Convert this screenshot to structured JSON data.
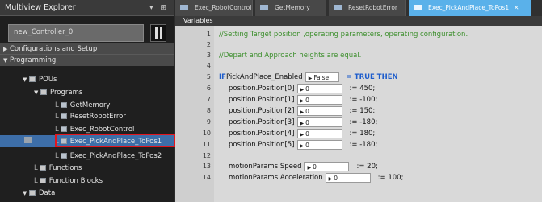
{
  "explorer": {
    "title": "Multiview Explorer",
    "controls": "▾ ⊞",
    "controller": "new_Controller_0",
    "tree": [
      {
        "label": "Configurations and Setup",
        "level": 0,
        "arrow": "▶"
      },
      {
        "label": "Programming",
        "level": 0,
        "arrow": "▼"
      },
      {
        "label": "POUs",
        "level": 1,
        "arrow": "▼"
      },
      {
        "label": "Programs",
        "level": 2,
        "arrow": "▼"
      },
      {
        "label": "GetMemory",
        "level": 3
      },
      {
        "label": "ResetRobotError",
        "level": 3
      },
      {
        "label": "Exec_RobotControl",
        "level": 3
      },
      {
        "label": "Exec_PickAndPlace_ToPos1",
        "level": 3,
        "selected": true
      },
      {
        "label": "Exec_PickAndPlace_ToPos2",
        "level": 3
      },
      {
        "label": "Functions",
        "level": 2
      },
      {
        "label": "Function Blocks",
        "level": 2
      },
      {
        "label": "Data",
        "level": 1,
        "arrow": "▼"
      }
    ]
  },
  "tabs": [
    {
      "label": "Exec_RobotControl"
    },
    {
      "label": "GetMemory"
    },
    {
      "label": "ResetRobotError"
    },
    {
      "label": "Exec_PickAndPlace_ToPos1",
      "active": true,
      "close": "✕"
    }
  ],
  "editor": {
    "variables_label": "Variables",
    "lines": [
      {
        "n": "1",
        "comment": "//Setting Target position ,operating parameters, operating configuration."
      },
      {
        "n": "2"
      },
      {
        "n": "3",
        "comment": "//Depart and Approach heights are equal."
      },
      {
        "n": "4"
      },
      {
        "n": "5",
        "if": true,
        "var": "PickAndPlace_Enabled",
        "value": "False",
        "rest": "= TRUE THEN"
      },
      {
        "n": "6",
        "var": "position.Position[0]",
        "value": "0",
        "rest": ":= 450;"
      },
      {
        "n": "7",
        "var": "position.Position[1]",
        "value": "0",
        "rest": ":= -100;"
      },
      {
        "n": "8",
        "var": "position.Position[2]",
        "value": "0",
        "rest": ":= 150;"
      },
      {
        "n": "9",
        "var": "position.Position[3]",
        "value": "0",
        "rest": ":= -180;"
      },
      {
        "n": "10",
        "var": "position.Position[4]",
        "value": "0",
        "rest": ":= 180;"
      },
      {
        "n": "11",
        "var": "position.Position[5]",
        "value": "0",
        "rest": ":= -180;"
      },
      {
        "n": "12"
      },
      {
        "n": "13",
        "var": "motionParams.Speed",
        "value": "0",
        "rest": ":= 20;"
      },
      {
        "n": "14",
        "var": "motionParams.Acceleration",
        "value": "0",
        "rest": ":= 100;"
      }
    ]
  }
}
